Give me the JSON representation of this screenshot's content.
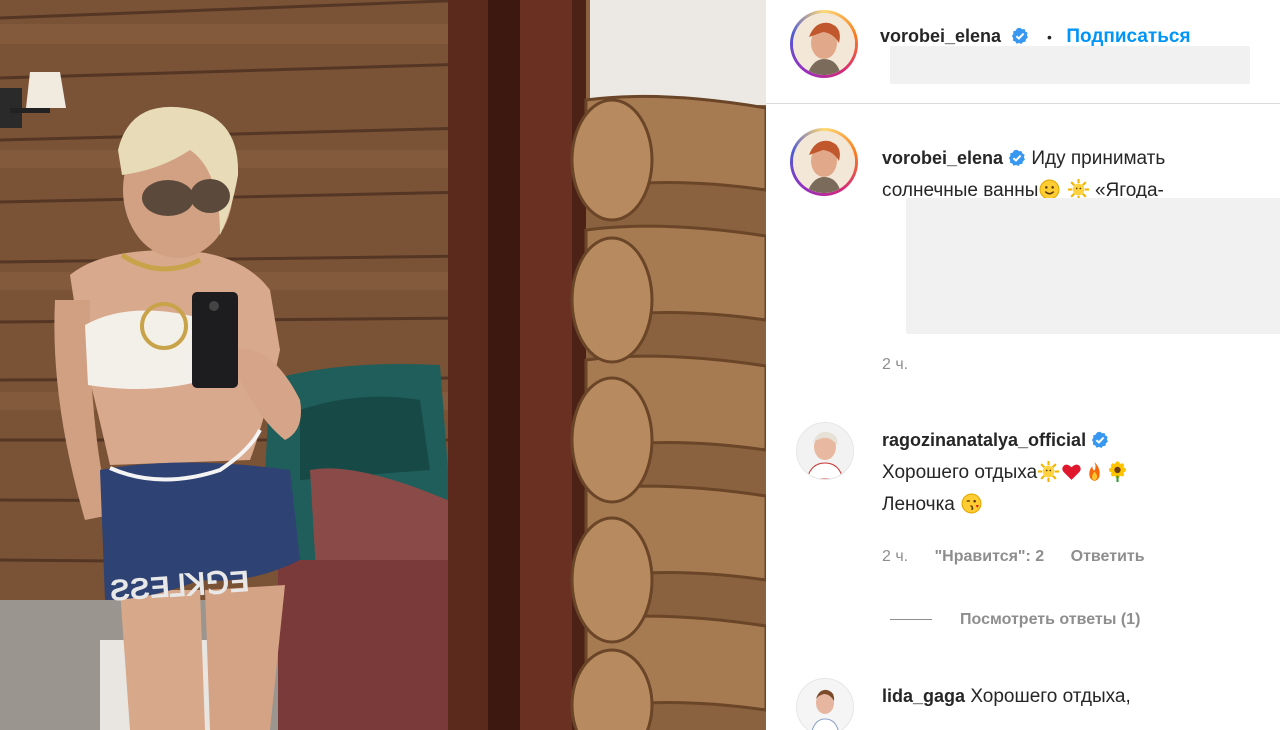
{
  "post": {
    "author": "vorobei_elena",
    "follow_label": "Подписаться",
    "dot": "•"
  },
  "caption": {
    "author": "vorobei_elena",
    "text_line1": "Иду принимать",
    "text_line2_a": "солнечные ванны",
    "text_line2_b": "«Ягода-",
    "time": "2 ч."
  },
  "comments": [
    {
      "author": "ragozinanatalya_official",
      "text_a": "Хорошего отдыха",
      "text_b": "Леночка",
      "time": "2 ч.",
      "likes_label": "\"Нравится\": 2",
      "reply_label": "Ответить",
      "view_replies": "Посмотреть ответы (1)"
    },
    {
      "author": "lida_gaga",
      "text": "Хорошего отдыха,"
    }
  ],
  "colors": {
    "accent": "#0095f6",
    "verified": "#3897f0",
    "muted": "#8e8e8e",
    "text": "#262626"
  },
  "icons": [
    "verified-badge-icon",
    "smile-emoji-icon",
    "sun-emoji-icon",
    "heart-emoji-icon",
    "fire-emoji-icon",
    "sunflower-emoji-icon",
    "wink-kiss-emoji-icon"
  ]
}
